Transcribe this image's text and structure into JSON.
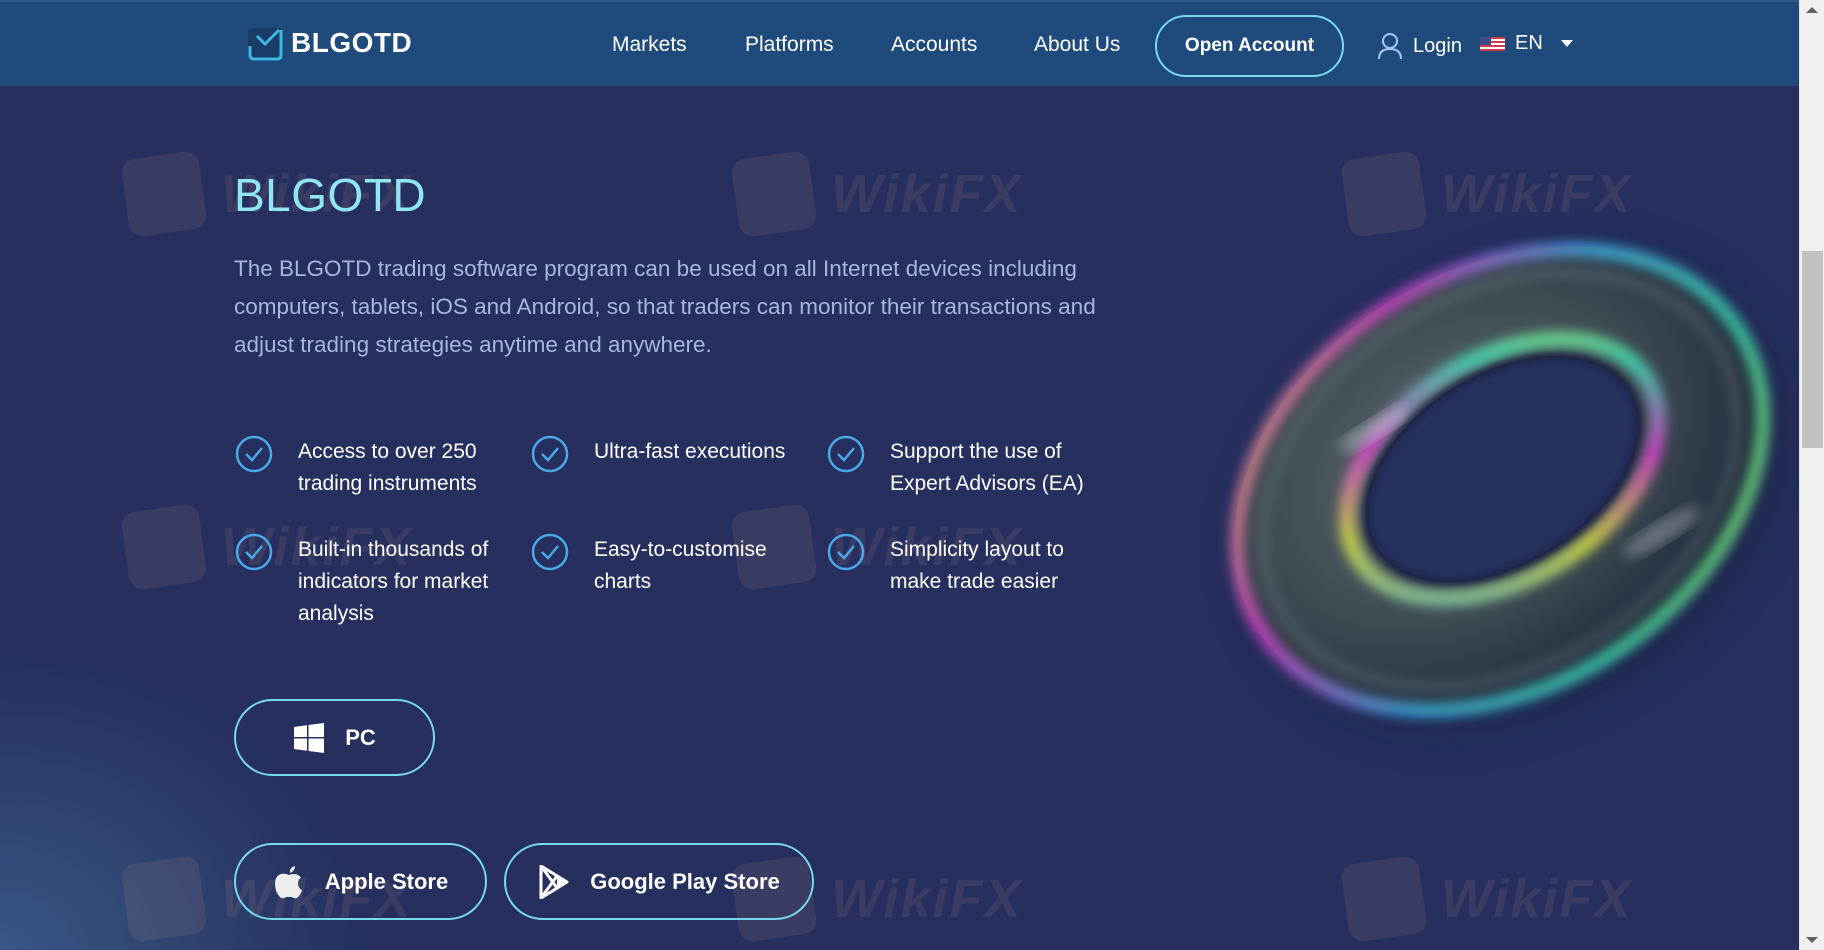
{
  "header": {
    "brand": "BLGOTD",
    "nav": [
      {
        "label": "Markets"
      },
      {
        "label": "Platforms"
      },
      {
        "label": "Accounts"
      },
      {
        "label": "About Us"
      }
    ],
    "open_account_label": "Open Account",
    "login_label": "Login",
    "language": "EN"
  },
  "hero": {
    "title": "BLGOTD",
    "description": "The BLGOTD trading software program can be used on all Internet devices including computers, tablets, iOS and Android, so that traders can monitor their transactions and adjust trading strategies anytime and anywhere.",
    "features": [
      {
        "text": "Access to over 250 trading instruments",
        "icon": "check-circle-icon"
      },
      {
        "text": "Ultra-fast executions",
        "icon": "check-circle-icon"
      },
      {
        "text": "Support the use of Expert Advisors (EA)",
        "icon": "check-circle-icon"
      },
      {
        "text": "Built-in thousands of indicators for market analysis",
        "icon": "check-circle-icon"
      },
      {
        "text": "Easy-to-customise charts",
        "icon": "check-circle-icon"
      },
      {
        "text": "Simplicity layout to make trade easier",
        "icon": "check-circle-icon"
      }
    ],
    "downloads": {
      "pc": {
        "label": "PC",
        "icon": "windows-icon"
      },
      "apple": {
        "label": "Apple Store",
        "icon": "apple-icon"
      },
      "google": {
        "label": "Google Play Store",
        "icon": "google-play-icon"
      }
    }
  },
  "watermark": {
    "text": "WikiFX"
  },
  "colors": {
    "header_bg": "#1f4a7c",
    "page_bg": "#262f5e",
    "accent": "#79d9ec",
    "title": "#8fe6f2",
    "body_text": "#a8b6de",
    "check_icon": "#4aa8e8"
  }
}
